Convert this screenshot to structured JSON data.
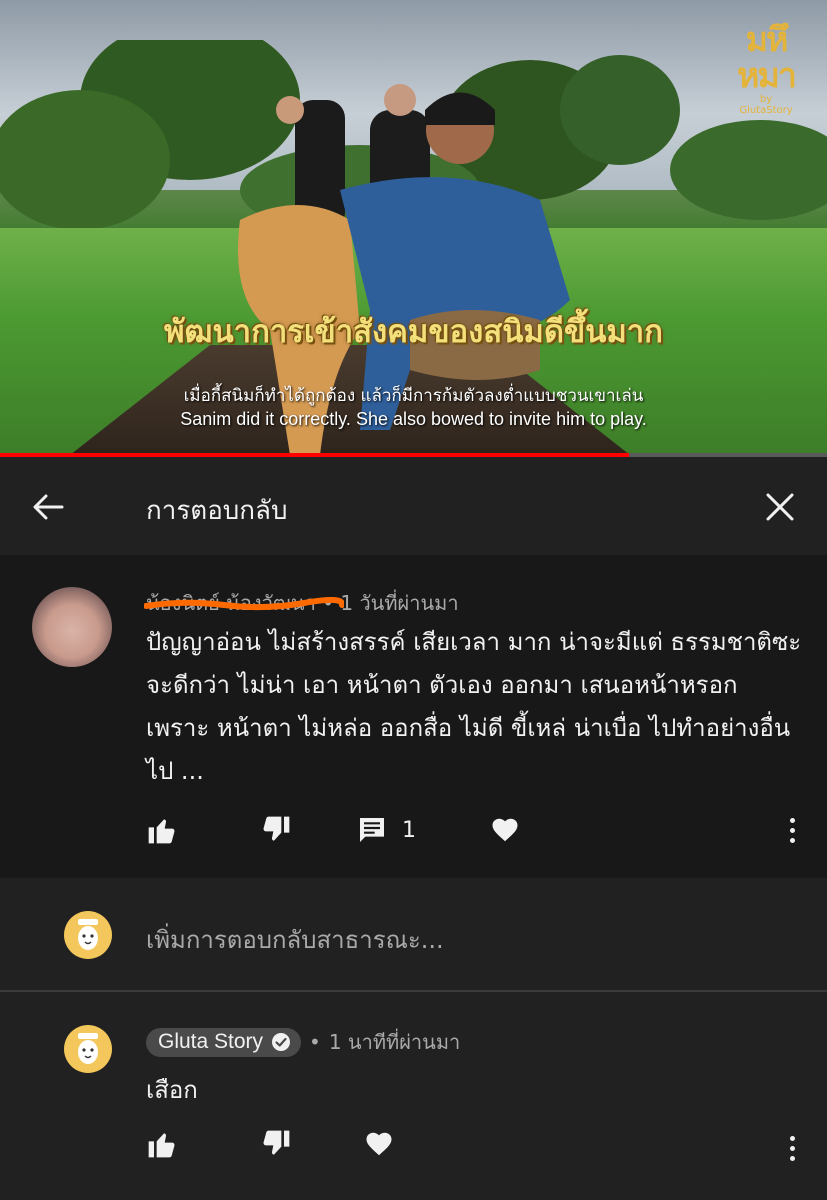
{
  "video": {
    "logo_text": "มหึ หมา",
    "logo_sub": "by GlutaStory",
    "title_overlay": "พัฒนาการเข้าสังคมของสนิมดีขึ้นมาก",
    "subtitle_th": "เมื่อกี้สนิมก็ทำได้ถูกต้อง แล้วก็มีการก้มตัวลงต่ำแบบชวนเขาเล่น",
    "subtitle_en": "Sanim did it correctly. She also bowed to invite him to play.",
    "progress": 0.76
  },
  "header": {
    "title": "การตอบกลับ",
    "back_icon": "arrow-left-icon",
    "close_icon": "close-icon"
  },
  "parent_comment": {
    "author": "น้องนิตย์ น้องวัฒนา",
    "separator": "•",
    "time": "1 วันที่ผ่านมา",
    "text": "ปัญญาอ่อน ไม่สร้างสรรค์ เสียเวลา มาก น่าจะมีแต่ ธรรมชาติซะ จะดีกว่า ไม่น่า เอา หน้าตา ตัวเอง ออกมา เสนอหน้าหรอก เพราะ หน้าตา ไม่หล่อ ออกสื่อ ไม่ดี ขี้เหล่ น่าเบื่อ ไปทำอย่างอื่น ไป ...",
    "reply_count": "1"
  },
  "add_reply": {
    "placeholder": "เพิ่มการตอบกลับสาธารณะ..."
  },
  "reply": {
    "author": "Gluta Story",
    "separator": "•",
    "time": "1 นาทีที่ผ่านมา",
    "text": "เสือก"
  },
  "colors": {
    "background": "#212121",
    "comment_bg": "#181818",
    "progress": "#ff0000",
    "secondary_text": "#aaaaaa",
    "scribble": "#ff6a00",
    "brand_yellow": "#f3c75b"
  }
}
